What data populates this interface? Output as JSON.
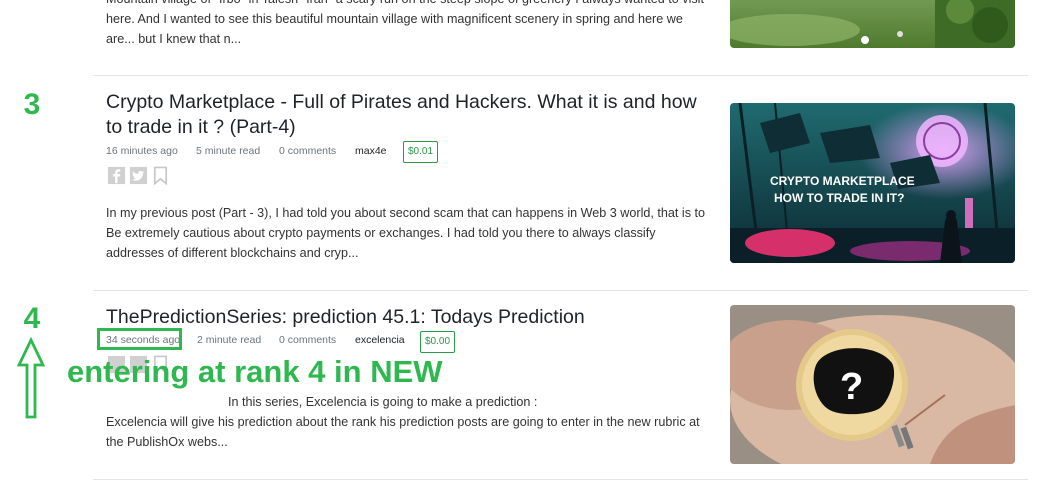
{
  "posts": [
    {
      "excerpt": "Mountain village of \"Irbo\" in Talesh \"Iran\" a scary run on the steep slope of greenery I always wanted to visit here. And I wanted to see this beautiful mountain village with magnificent scenery in spring and here we are... but I knew that n..."
    },
    {
      "rank": "3",
      "title": "Crypto Marketplace - Full of Pirates and Hackers. What it is and how to trade in it ? (Part-4)",
      "time_ago": "16 minutes ago",
      "read_time": "5 minute read",
      "comments": "0 comments",
      "author": "max4e",
      "price": "$0.01",
      "excerpt": "In my previous post (Part - 3), I had told you about second scam that can happens in Web 3 world, that is to Be extremely cautious about crypto payments or exchanges. I had told you there to always classify addresses of different blockchains and cryp...",
      "thumb_text_line1": "CRYPTO MARKETPLACE",
      "thumb_text_line2": "HOW TO TRADE IN IT?"
    },
    {
      "rank": "4",
      "title": "ThePredictionSeries: prediction 45.1: Todays Prediction",
      "time_ago": "34 seconds ago",
      "read_time": "2 minute read",
      "comments": "0 comments",
      "author": "excelencia",
      "price": "$0.00",
      "excerpt_line1": "In this  series, Excelencia is going  to make a  prediction :",
      "excerpt": "Excelencia will give his prediction about the rank his  prediction posts are going to enter in the new rubric at the PublishOx webs...",
      "thumb_symbol": "?"
    }
  ],
  "annotation": {
    "text": "entering at rank 4 in NEW",
    "color": "#2fb84f"
  },
  "icons": [
    "facebook-icon",
    "twitter-icon",
    "bookmark-icon",
    "arrow-up-icon"
  ]
}
